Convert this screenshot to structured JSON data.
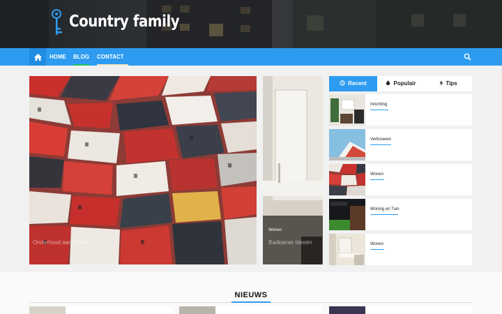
{
  "header": {
    "site_title": "Country family",
    "logo": "key-logo-icon"
  },
  "nav": {
    "items": [
      {
        "label": "HOME",
        "underline_color": ""
      },
      {
        "label": "BLOG",
        "underline_color": "#22c55e"
      },
      {
        "label": "CONTACT",
        "underline_color": "#f3e3c3"
      }
    ],
    "home_icon": "home-icon",
    "search_icon": "search-icon"
  },
  "hero": {
    "main_caption": "Onderhoud aan je dak",
    "side_category": "Wonen",
    "side_caption": "Badkamer ideeën"
  },
  "sidebar": {
    "tabs": [
      {
        "label": "Recent",
        "icon": "clock-icon"
      },
      {
        "label": "Populair",
        "icon": "flame-icon"
      },
      {
        "label": "Tips",
        "icon": "bolt-icon"
      }
    ],
    "posts": [
      {
        "category": "Inrichting"
      },
      {
        "category": "Verbouwen"
      },
      {
        "category": "Wonen"
      },
      {
        "category": "Woning en Tuin"
      },
      {
        "category": "Wonen"
      }
    ]
  },
  "section": {
    "title": "NIEUWS"
  },
  "colors": {
    "accent": "#2d9cf0",
    "nav_active": "#1f8ce0"
  }
}
